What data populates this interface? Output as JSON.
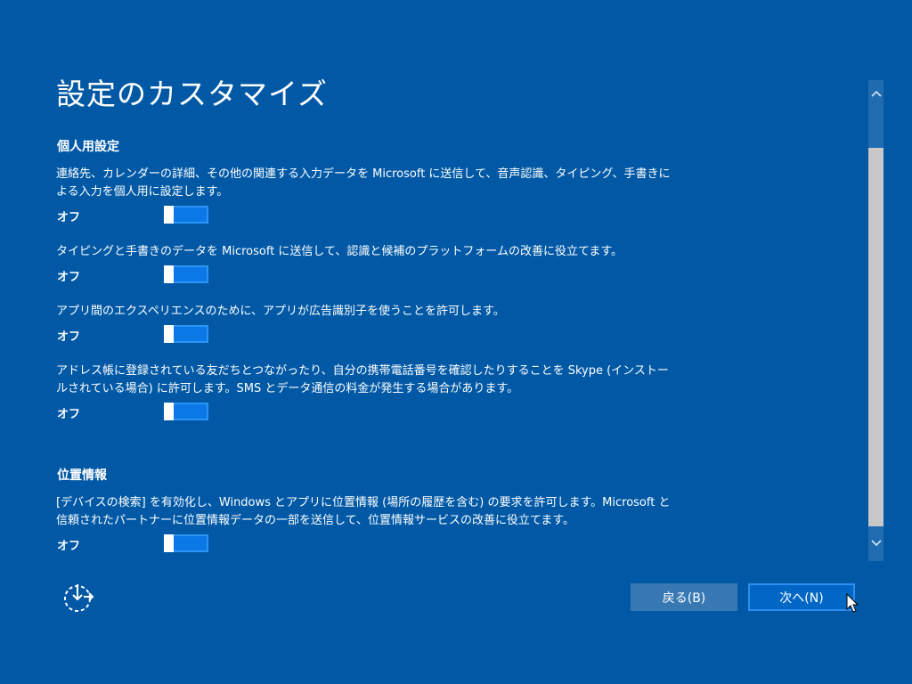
{
  "title": "設定のカスタマイズ",
  "sections": {
    "personal": {
      "heading": "個人用設定",
      "settings": [
        {
          "description": "連絡先、カレンダーの詳細、その他の関連する入力データを Microsoft に送信して、音声認識、タイピング、手書きによる入力を個人用に設定します。",
          "state": "オフ"
        },
        {
          "description": "タイピングと手書きのデータを Microsoft に送信して、認識と候補のプラットフォームの改善に役立てます。",
          "state": "オフ"
        },
        {
          "description": "アプリ間のエクスペリエンスのために、アプリが広告識別子を使うことを許可します。",
          "state": "オフ"
        },
        {
          "description": "アドレス帳に登録されている友だちとつながったり、自分の携帯電話番号を確認したりすることを Skype (インストールされている場合) に許可します。SMS とデータ通信の料金が発生する場合があります。",
          "state": "オフ"
        }
      ]
    },
    "location": {
      "heading": "位置情報",
      "settings": [
        {
          "description": "[デバイスの検索] を有効化し、Windows とアプリに位置情報 (場所の履歴を含む) の要求を許可します。Microsoft と信頼されたパートナーに位置情報データの一部を送信して、位置情報サービスの改善に役立てます。",
          "state": "オフ"
        }
      ]
    }
  },
  "buttons": {
    "back": "戻る(B)",
    "next": "次へ(N)"
  },
  "icons": {
    "accessibility": "ease-of-access-icon",
    "scroll_up": "chevron-up-icon",
    "scroll_down": "chevron-down-icon",
    "cursor": "mouse-pointer-icon"
  },
  "colors": {
    "background": "#0159a6",
    "toggle_fill": "#0a78e6",
    "toggle_border": "#2c94f5",
    "back_button": "#3979b3",
    "next_button": "#0167c4"
  }
}
